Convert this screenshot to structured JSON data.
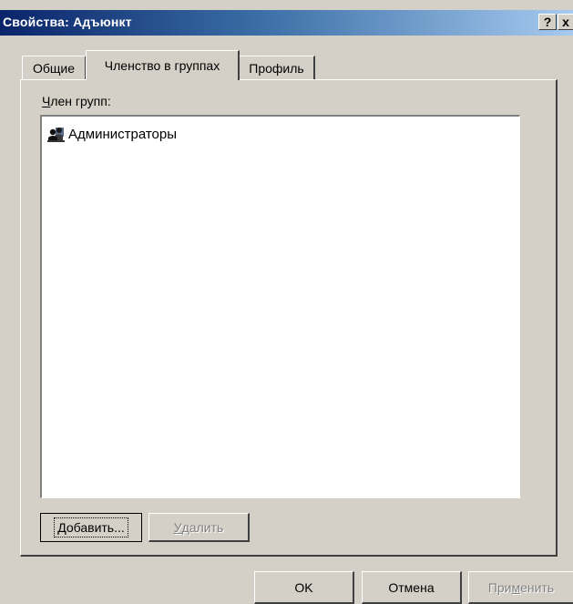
{
  "window": {
    "title": "Свойства: Адъюнкт",
    "help_button": "?",
    "close_button": "x"
  },
  "tabs": [
    {
      "label": "Общие",
      "active": false
    },
    {
      "label": "Членство в группах",
      "active": true
    },
    {
      "label": "Профиль",
      "active": false
    }
  ],
  "membership": {
    "label_accel": "Ч",
    "label_rest": "лен групп:",
    "groups": [
      {
        "name": "Администраторы",
        "icon": "group-icon"
      }
    ]
  },
  "buttons": {
    "add_accel": "Д",
    "add_rest": "обавить...",
    "remove_accel": "У",
    "remove_rest": "далить",
    "ok": "OK",
    "cancel": "Отмена",
    "apply_pre": "При",
    "apply_accel": "м",
    "apply_post": "енить"
  },
  "colors": {
    "title_start": "#0a246a",
    "title_end": "#a6caf0",
    "face": "#d4d0c8"
  }
}
